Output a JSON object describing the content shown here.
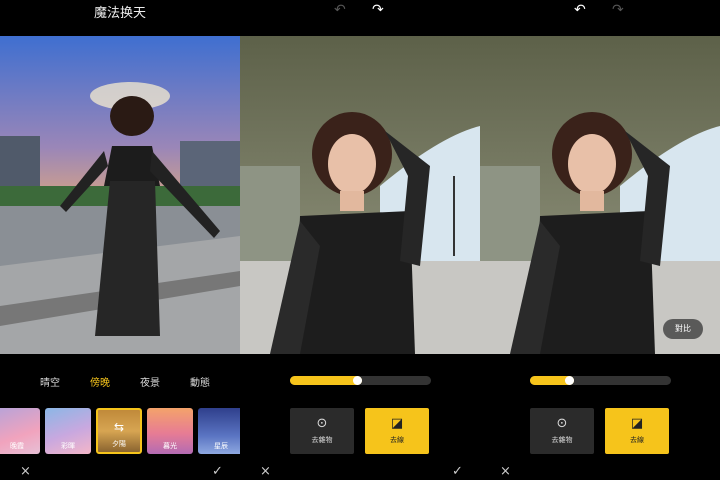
{
  "panel1": {
    "title": "魔法换天",
    "tabs": [
      {
        "label": "晴空",
        "active": false
      },
      {
        "label": "傍晚",
        "active": true
      },
      {
        "label": "夜景",
        "active": false
      },
      {
        "label": "動態",
        "active": false
      }
    ],
    "thumbs": [
      {
        "label": "晚霞"
      },
      {
        "label": "彩暉"
      },
      {
        "label": "夕陽",
        "selected": true
      },
      {
        "label": "暮光"
      },
      {
        "label": "星辰"
      }
    ],
    "cancel_icon": "×",
    "confirm_icon": "✓",
    "adjust_icon": "⇆"
  },
  "panel2": {
    "undo_icon": "↶",
    "redo_icon": "↷",
    "progress": 0.51,
    "buttons": {
      "remove_object": "去雜物",
      "remove_lines": "去線"
    },
    "cancel_icon": "×",
    "confirm_icon": "✓"
  },
  "panel3": {
    "undo_icon": "↶",
    "redo_icon": "↷",
    "progress": 0.31,
    "compare_label": "對比",
    "buttons": {
      "remove_object": "去雜物",
      "remove_lines": "去線"
    },
    "cancel_icon": "×"
  },
  "colors": {
    "accent": "#f6c41b",
    "button_dark": "#2b2b2b",
    "track": "#333333"
  }
}
